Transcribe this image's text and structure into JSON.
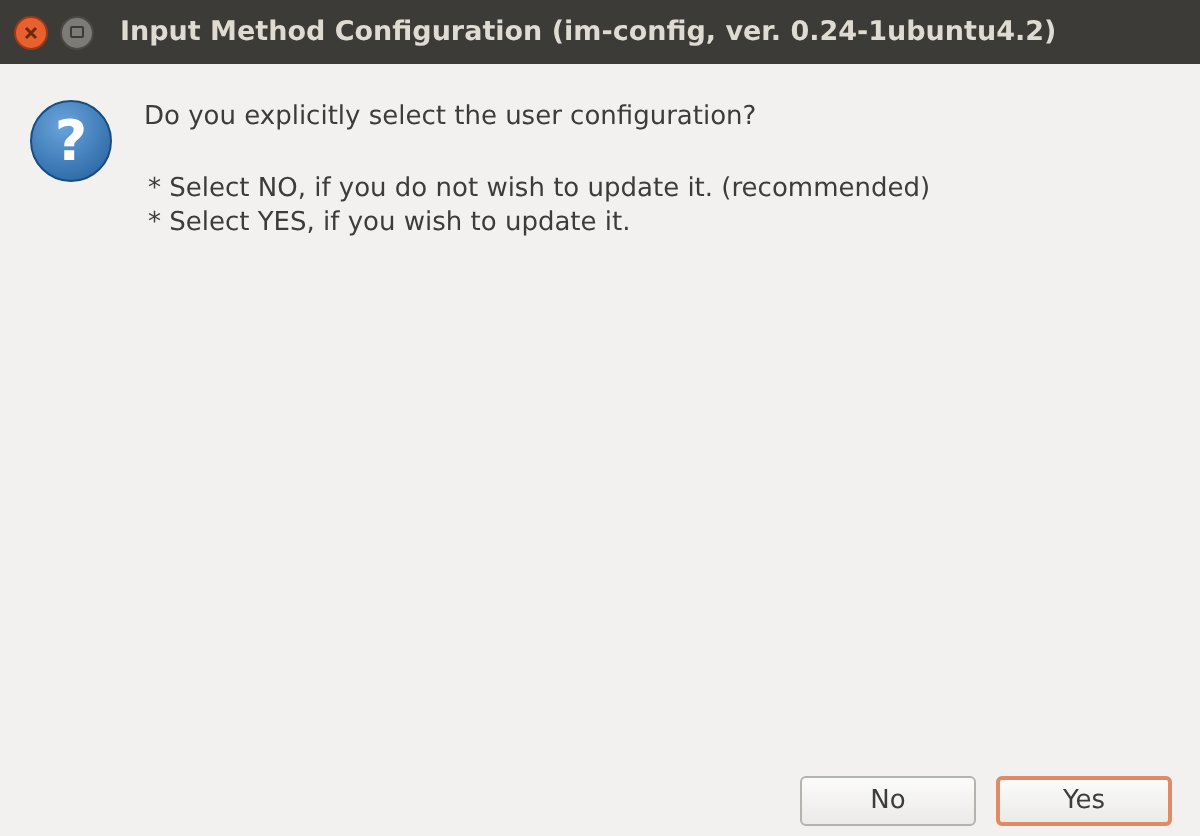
{
  "window": {
    "title": "Input Method Configuration (im-config, ver. 0.24-1ubuntu4.2)"
  },
  "dialog": {
    "icon_glyph": "?",
    "question": "Do you explicitly select the user configuration?",
    "details": [
      "* Select NO, if you do not wish to update it. (recommended)",
      "* Select YES, if you wish to update it."
    ]
  },
  "buttons": [
    {
      "label": "No",
      "default": false
    },
    {
      "label": "Yes",
      "default": true
    }
  ]
}
